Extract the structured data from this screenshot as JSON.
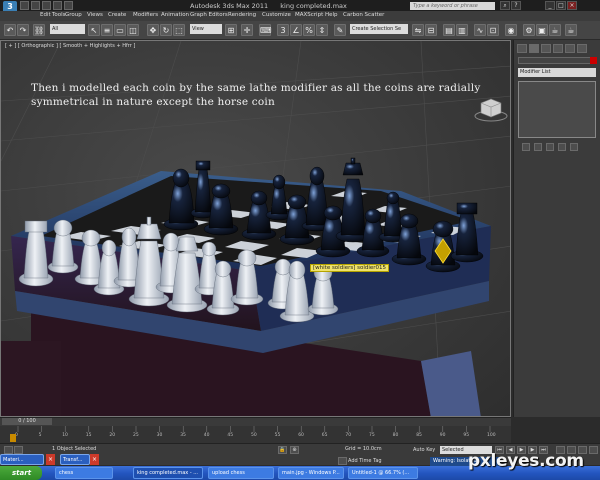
{
  "window": {
    "app_name": "Autodesk 3ds Max  2011",
    "file_name": "king completed.max",
    "search_placeholder": "Type a keyword or phrase"
  },
  "menus": [
    "Edit",
    "Tools",
    "Group",
    "Views",
    "Create",
    "Modifiers",
    "Animation",
    "Graph Editors",
    "Rendering",
    "Customize",
    "MAXScript",
    "Help",
    "Carbon Scatter"
  ],
  "toolbar": {
    "selection_filter": "All",
    "ref_coord": "View",
    "named_selection": "Create Selection Se"
  },
  "viewport": {
    "label": "[ + ] [ Orthographic ] [ Smooth + Highlights + Hfrr ]",
    "caption": "Then i modelled each coin by the same lathe modifier as all the coins are radially symmetrical in nature except the horse coin",
    "tooltip": "[white soldiers] soldier015"
  },
  "command_panel": {
    "modifier_list": "Modifier List"
  },
  "timeline": {
    "frame_counter": "0 / 100",
    "ticks": [
      "0",
      "5",
      "10",
      "15",
      "20",
      "25",
      "30",
      "35",
      "40",
      "45",
      "50",
      "55",
      "60",
      "65",
      "70",
      "75",
      "80",
      "85",
      "90",
      "95",
      "100"
    ]
  },
  "status": {
    "selected_text": "1 Object Selected",
    "grid_text": "Grid = 10.0cm",
    "add_time_tag": "Add Time Tag",
    "auto_key": "Auto Key",
    "set_key": "Set Key",
    "selected_dropdown": "Selected",
    "key_filters": "Key Filters...",
    "warning": "Warning: Isolated"
  },
  "floating_windows": {
    "material": "Materi...",
    "transform": "Transf..."
  },
  "taskbar": {
    "start": "start",
    "tasks": [
      "chess",
      "king completed.max - ...",
      "upload chess",
      "main.jpg - Windows P...",
      "Untitled-1 @ 66.7% (..."
    ]
  },
  "watermark": "pxleyes.com"
}
